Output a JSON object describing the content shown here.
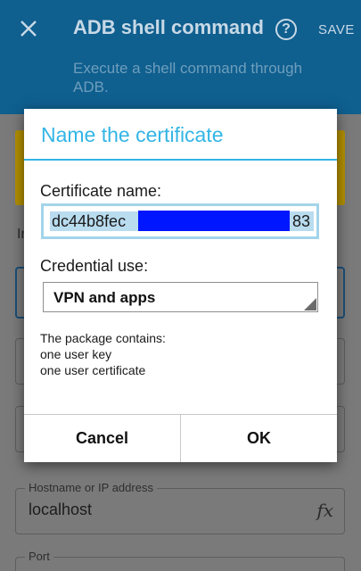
{
  "appbar": {
    "title": "ADB shell command",
    "help_glyph": "?",
    "save_label": "SAVE",
    "subtitle": "Execute a shell command through ADB."
  },
  "background": {
    "section_label_partial": "In",
    "host_label": "Hostname or IP address",
    "host_value": "localhost",
    "fx_glyph": "fx",
    "port_label": "Port"
  },
  "dialog": {
    "title": "Name the certificate",
    "cert_name_label": "Certificate name:",
    "cert_name_start": "dc44b8fec",
    "cert_name_end": "83",
    "credential_use_label": "Credential use:",
    "credential_use_value": "VPN and apps",
    "package_header": "The package contains:",
    "package_items": [
      "one user key",
      "one user certificate"
    ],
    "cancel_label": "Cancel",
    "ok_label": "OK"
  },
  "colors": {
    "appbar": "#0f5f8f",
    "dialog_accent": "#33b5e5",
    "redaction": "#0016ff",
    "warning_card": "#b38f00"
  }
}
